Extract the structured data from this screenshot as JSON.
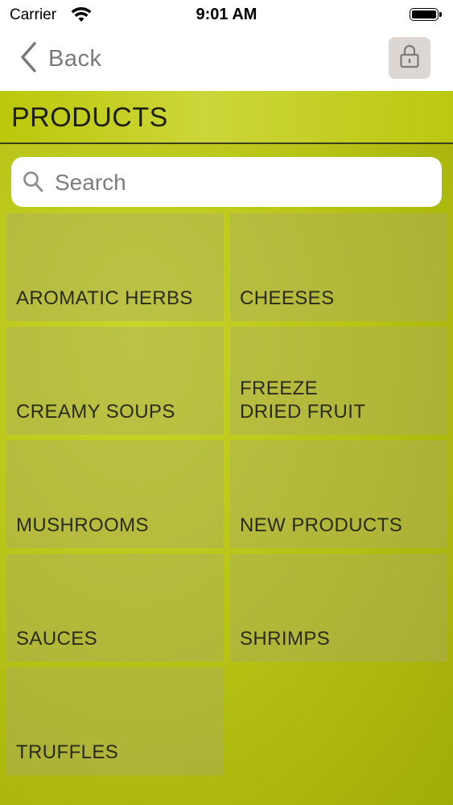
{
  "status_bar": {
    "carrier": "Carrier",
    "time": "9:01 AM",
    "wifi_icon": "wifi-icon",
    "battery_icon": "battery-icon"
  },
  "nav": {
    "back_label": "Back",
    "back_icon": "chevron-left-icon",
    "lock_icon": "lock-icon"
  },
  "page": {
    "title": "PRODUCTS"
  },
  "search": {
    "placeholder": "Search",
    "value": "",
    "icon": "search-icon"
  },
  "categories": [
    {
      "label": "AROMATIC HERBS"
    },
    {
      "label": "CHEESES"
    },
    {
      "label": "CREAMY SOUPS"
    },
    {
      "label": "FREEZE\nDRIED FRUIT"
    },
    {
      "label": "MUSHROOMS"
    },
    {
      "label": "NEW PRODUCTS"
    },
    {
      "label": "SAUCES"
    },
    {
      "label": "SHRIMPS"
    },
    {
      "label": "TRUFFLES"
    }
  ],
  "colors": {
    "accent": "#bcc80a",
    "tile": "#b3b86a",
    "nav_text": "#7a7a7a",
    "lock_button_bg": "#dcd7d2"
  }
}
